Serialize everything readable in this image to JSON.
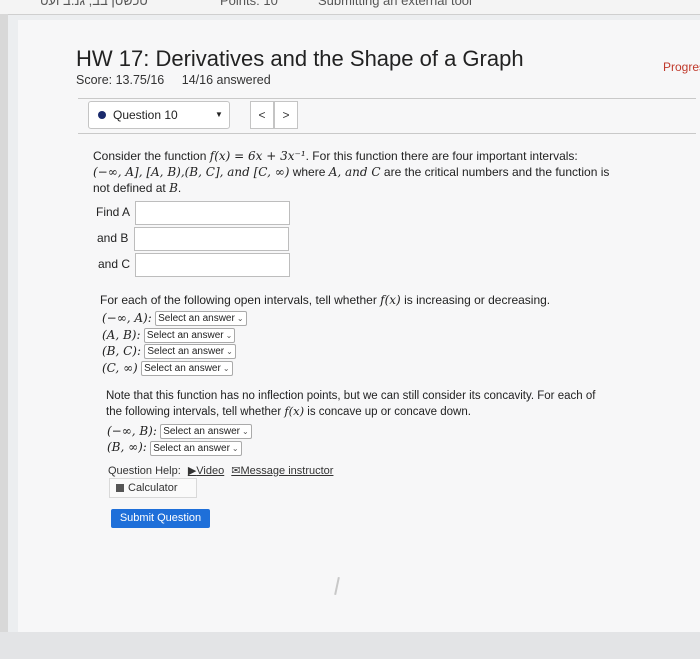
{
  "topbar": {
    "tab1": "טכשטן בב, גנ.ב ועט",
    "tab2": "Points: 10",
    "tab3": "Submitting an external tool"
  },
  "header": {
    "title": "HW 17: Derivatives and the Shape of a Graph",
    "score": "Score: 13.75/16",
    "answered": "14/16 answered",
    "progress": "Progres"
  },
  "question_nav": {
    "selected": "Question 10",
    "prev": "<",
    "next": ">"
  },
  "question": {
    "intro_1": "Consider the function ",
    "func": "f(x) = 6x + 3x⁻¹",
    "intro_2": ". For this function there are four important intervals:",
    "intervals": "(−∞, A], [A, B),(B, C], and [C, ∞)",
    "intro_3": " where ",
    "vars": "A, and C",
    "intro_4": " are the critical numbers and the function is",
    "intro_5": "not defined at ",
    "B": "B",
    "period": ".",
    "find_a": "Find A",
    "and_b": "and B",
    "and_c": "and C",
    "inc_dec_1": "For each of the following open intervals, tell whether ",
    "fx": "f(x)",
    "inc_dec_2": " is increasing or decreasing.",
    "interval_rows": [
      "(−∞, A):",
      "(A, B):",
      "(B, C):",
      "(C, ∞)"
    ],
    "select_placeholder": "Select an answer",
    "concavity_1": "Note that this function has no inflection points, but we can still consider its concavity. For each of",
    "concavity_2": "the following intervals, tell whether ",
    "concavity_3": " is concave up or concave down.",
    "concavity_rows": [
      "(−∞, B):",
      "(B, ∞):"
    ]
  },
  "help": {
    "label": "Question Help:",
    "video": "Video",
    "message": "Message instructor",
    "calculator": "Calculator"
  },
  "submit_label": "Submit Question"
}
